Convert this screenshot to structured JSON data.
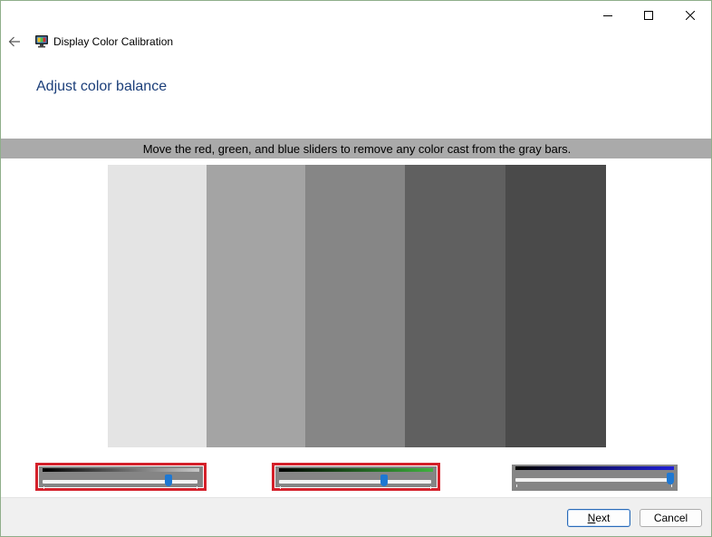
{
  "window": {
    "title": "Display Color Calibration",
    "controls": {
      "minimize": "minimize-icon",
      "maximize": "maximize-icon",
      "close": "close-icon"
    }
  },
  "header": {
    "back_icon": "back-arrow-icon",
    "app_icon": "monitor-color-icon",
    "heading": "Adjust color balance"
  },
  "instruction": "Move the red, green, and blue sliders to remove any color cast from the gray bars.",
  "gray_bars": [
    "#e4e4e4",
    "#a4a4a4",
    "#868686",
    "#606060",
    "#4a4a4a"
  ],
  "sliders": [
    {
      "channel": "red",
      "strip_color": "#c8c8c8",
      "value": 0.81,
      "highlighted": true
    },
    {
      "channel": "green",
      "strip_color": "#3fb23f",
      "value": 0.69,
      "highlighted": true
    },
    {
      "channel": "blue",
      "strip_color": "#2020d8",
      "value": 0.99,
      "highlighted": false
    }
  ],
  "colors": {
    "highlight": "#d4202a",
    "thumb": "#1e78d2",
    "heading": "#1c3f7a"
  },
  "footer": {
    "next_label": "Next",
    "cancel_label": "Cancel"
  }
}
